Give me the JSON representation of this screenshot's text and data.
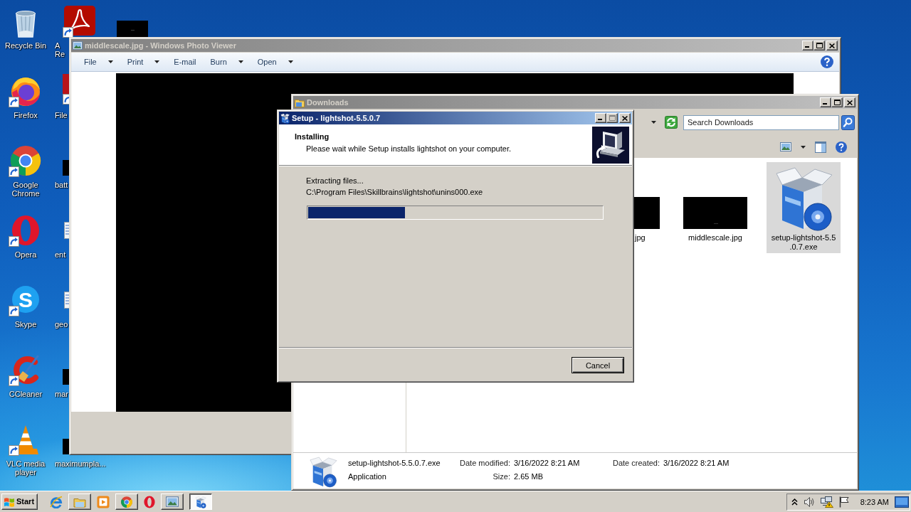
{
  "desktop": {
    "columns": [
      {
        "icons": [
          {
            "label": "Recycle Bin",
            "kind": "recyclebin",
            "shortcut": false
          },
          {
            "label": "Firefox",
            "kind": "firefox",
            "shortcut": true
          },
          {
            "label": "Google Chrome",
            "kind": "chrome",
            "shortcut": true
          },
          {
            "label": "Opera",
            "kind": "opera",
            "shortcut": true
          },
          {
            "label": "Skype",
            "kind": "skype",
            "glyph": "S",
            "shortcut": true
          },
          {
            "label": "CCleaner",
            "kind": "ccleaner",
            "shortcut": true
          },
          {
            "label": "VLC media player",
            "kind": "vlc",
            "shortcut": true
          }
        ]
      },
      {
        "icons": [
          {
            "label": "A\nRe",
            "kind": "pdf",
            "shortcut": true
          },
          {
            "label": "File",
            "kind": "cutapp",
            "shortcut": true
          },
          {
            "label": "batt",
            "kind": "cutthumb",
            "shortcut": false
          },
          {
            "label": "ent",
            "kind": "cutdoc",
            "shortcut": false
          },
          {
            "label": "geo",
            "kind": "cutdoc",
            "shortcut": false
          },
          {
            "label": "mar",
            "kind": "cutthumb",
            "shortcut": false
          },
          {
            "label": "maximumpla...",
            "kind": "cutthumb",
            "shortcut": false
          }
        ]
      },
      {
        "icons": [
          {
            "kind": "topthumb",
            "shortcut": false
          }
        ]
      }
    ]
  },
  "photo_viewer": {
    "title": "middlescale.jpg - Windows Photo Viewer",
    "active": false,
    "controls": [
      {
        "kind": "minimize",
        "disabled": false
      },
      {
        "kind": "maximize",
        "disabled": false
      },
      {
        "kind": "close",
        "disabled": false
      }
    ],
    "menu": [
      {
        "label": "File",
        "dropdown": true
      },
      {
        "label": "Print",
        "dropdown": true
      },
      {
        "label": "E-mail",
        "dropdown": false
      },
      {
        "label": "Burn",
        "dropdown": true
      },
      {
        "label": "Open",
        "dropdown": true
      }
    ]
  },
  "explorer": {
    "title": "Downloads",
    "active": false,
    "controls": [
      {
        "kind": "minimize",
        "disabled": false
      },
      {
        "kind": "maximize",
        "disabled": false
      },
      {
        "kind": "close",
        "disabled": false
      }
    ],
    "search": {
      "placeholder": "Search Downloads"
    },
    "files": [
      {
        "name": ".jpg",
        "kind": "imageedge",
        "selected": false
      },
      {
        "name": "middlescale.jpg",
        "kind": "image",
        "selected": false
      },
      {
        "name": "setup-lightshot-5.5.0.7.exe",
        "kind": "installer",
        "selected": true
      }
    ],
    "details": {
      "name": "setup-lightshot-5.5.0.7.exe",
      "type": "Application",
      "properties": [
        {
          "label": "Date modified:",
          "value": "3/16/2022 8:21 AM"
        },
        {
          "label": "Size:",
          "value": "2.65 MB"
        },
        {
          "label": "Date created:",
          "value": "3/16/2022 8:21 AM"
        }
      ]
    }
  },
  "setup": {
    "title": "Setup - lightshot-5.5.0.7",
    "active": true,
    "controls": [
      {
        "kind": "minimize",
        "disabled": false
      },
      {
        "kind": "maximize",
        "disabled": true
      },
      {
        "kind": "close",
        "disabled": false
      }
    ],
    "heading": "Installing",
    "subheading": "Please wait while Setup installs lightshot on your computer.",
    "status": "Extracting files...",
    "file": "C:\\Program Files\\Skillbrains\\lightshot\\unins000.exe",
    "progress": {
      "level": 0.33
    },
    "buttons": [
      {
        "label": "Cancel",
        "default": true
      }
    ]
  },
  "taskbar": {
    "start": "Start",
    "items": [
      {
        "kind": "ie",
        "running": false,
        "selected": false
      },
      {
        "kind": "folder",
        "running": true,
        "selected": false
      },
      {
        "kind": "media",
        "running": false,
        "selected": false
      },
      {
        "kind": "chrome",
        "running": true,
        "selected": false
      },
      {
        "kind": "opera",
        "running": false,
        "selected": false
      },
      {
        "kind": "picture",
        "running": true,
        "selected": false
      },
      {
        "kind": "installer",
        "running": true,
        "selected": true
      }
    ],
    "tray": [
      {
        "kind": "chevron"
      },
      {
        "kind": "speaker"
      },
      {
        "kind": "network"
      },
      {
        "kind": "flag"
      },
      {
        "kind": "clock",
        "text": "8:23 AM"
      },
      {
        "kind": "desktop"
      }
    ]
  }
}
